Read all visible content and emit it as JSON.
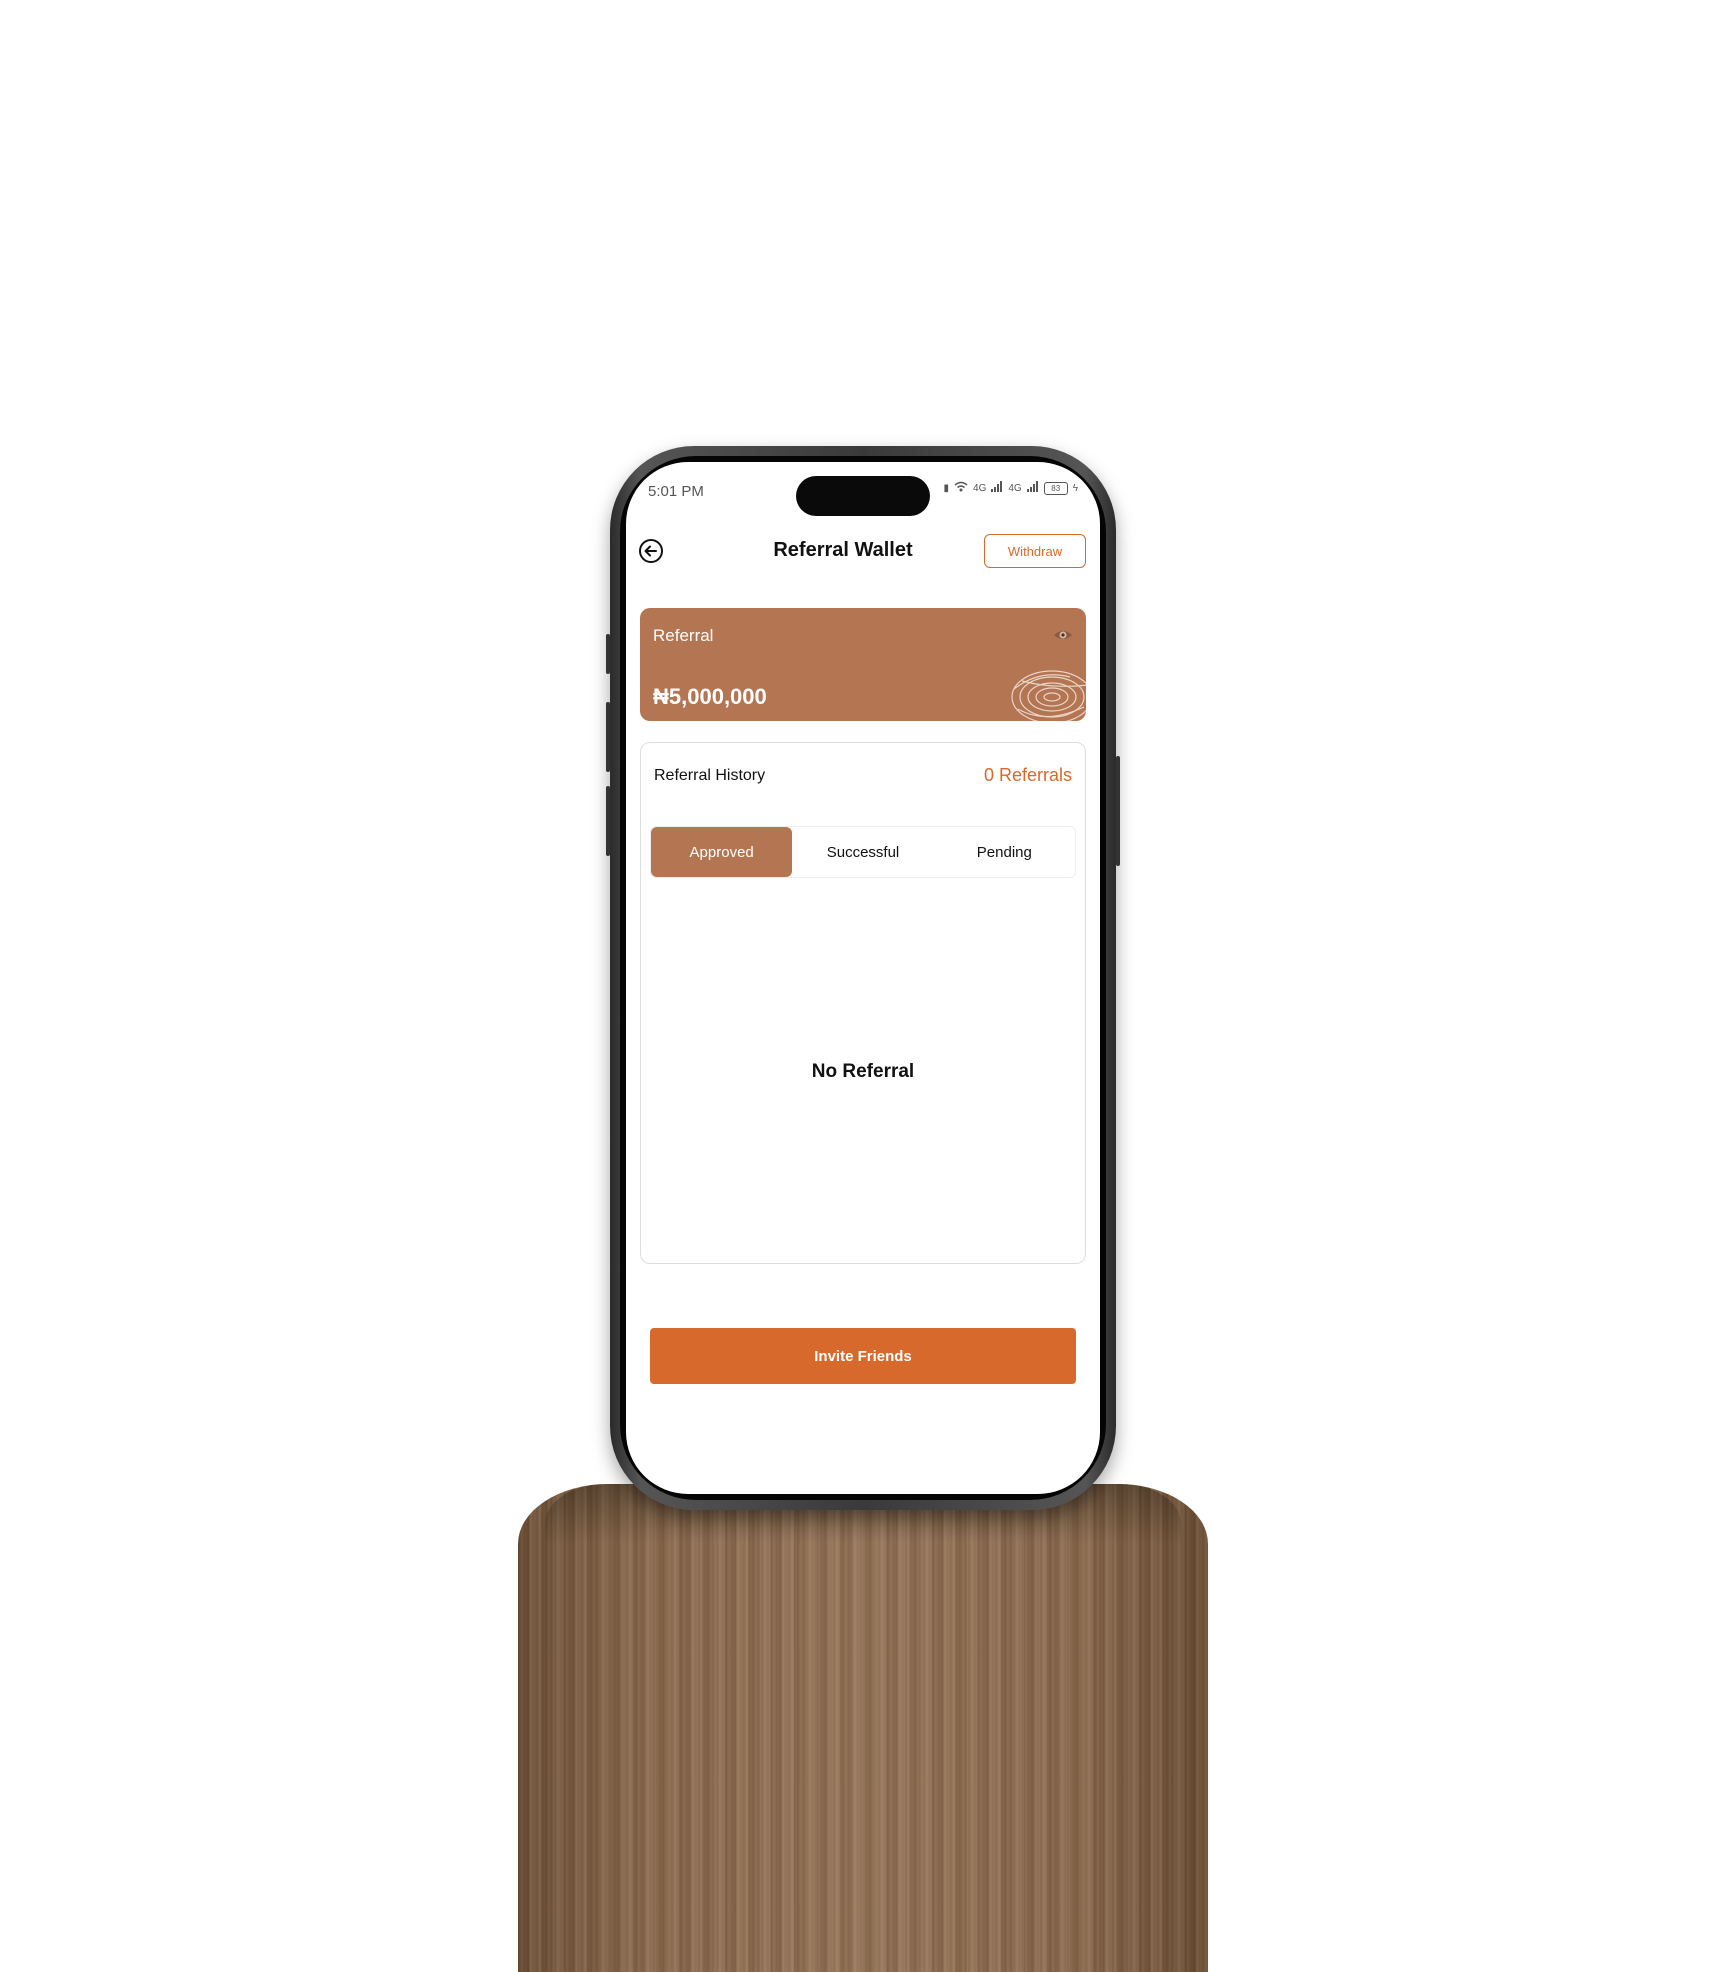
{
  "status_bar": {
    "time": "5:01 PM",
    "network_1": "4G",
    "network_2": "4G",
    "battery": "83"
  },
  "header": {
    "title": "Referral Wallet",
    "withdraw_label": "Withdraw"
  },
  "wallet": {
    "label": "Referral",
    "amount": "₦5,000,000"
  },
  "history": {
    "title": "Referral History",
    "count": "0 Referrals",
    "tabs": [
      {
        "label": "Approved",
        "active": true
      },
      {
        "label": "Successful",
        "active": false
      },
      {
        "label": "Pending",
        "active": false
      }
    ],
    "empty_text": "No Referral"
  },
  "footer": {
    "invite_label": "Invite Friends"
  },
  "colors": {
    "accent": "#d6692b",
    "card": "#b47552"
  }
}
